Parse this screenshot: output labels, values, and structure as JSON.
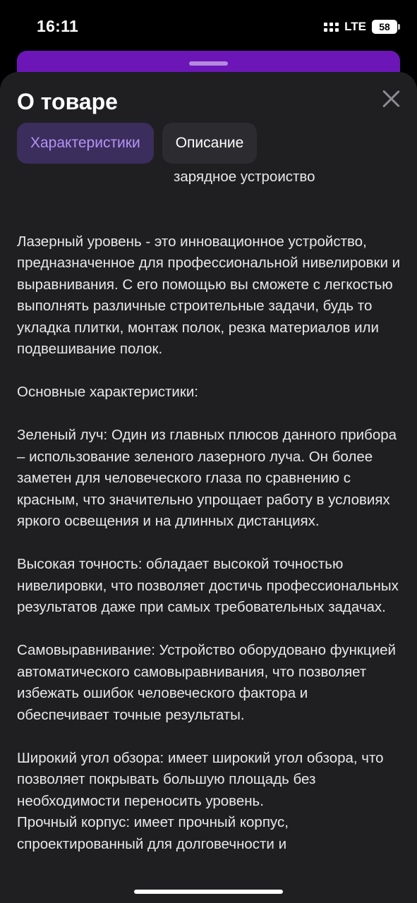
{
  "status_bar": {
    "time": "16:11",
    "network": "LTE",
    "battery": "58"
  },
  "sheet": {
    "title": "О товаре",
    "tabs": [
      {
        "label": "Характеристики",
        "active": true
      },
      {
        "label": "Описание",
        "active": false
      }
    ],
    "subline": "зарядное устроиство",
    "paragraphs": [
      "Лазерный уровень - это инновационное устройство, предназначенное для профессиональной нивелировки и выравнивания. С его помощью вы сможете с легкостью выполнять различные строительные задачи, будь то укладка плитки, монтаж полок, резка материалов или подвешивание полок.",
      "Основные характеристики:",
      "Зеленый луч: Один из главных плюсов данного прибора – использование зеленого лазерного луча. Он более заметен для человеческого глаза по сравнению с красным, что значительно упрощает работу в условиях яркого освещения и на длинных дистанциях.",
      "Высокая точность: обладает высокой точностью нивелировки, что позволяет достичь профессиональных результатов даже при самых требовательных задачах.",
      "Самовыравнивание: Устройство оборудовано функцией автоматического самовыравнивания, что позволяет избежать ошибок человеческого фактора и обеспечивает точные результаты.",
      "Широкий угол обзора: имеет широкий угол обзора, что позволяет покрывать большую площадь без необходимости переносить уровень.",
      "Прочный корпус: имеет прочный корпус, спроектированный для долговечности и"
    ]
  },
  "colors": {
    "accent": "#b594f3",
    "accent_bg": "#3b2d5c",
    "sheet_bg": "#1f1f22",
    "under_card": "#6d16b8"
  }
}
